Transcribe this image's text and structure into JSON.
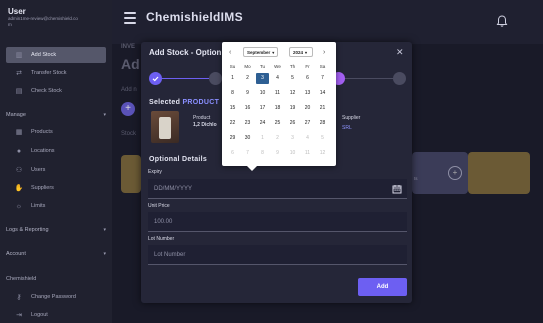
{
  "sidebar": {
    "user_name": "User",
    "user_email": "admin1me-review@chemishield.com",
    "nav_primary": [
      {
        "label": "Add Stock",
        "icon": "barcode-icon",
        "active": true
      },
      {
        "label": "Transfer Stock",
        "icon": "transfer-icon",
        "active": false
      },
      {
        "label": "Check Stock",
        "icon": "scan-icon",
        "active": false
      }
    ],
    "manage_heading": "Manage",
    "manage_items": [
      {
        "label": "Products",
        "icon": "box-icon"
      },
      {
        "label": "Locations",
        "icon": "pin-icon"
      },
      {
        "label": "Users",
        "icon": "users-icon"
      },
      {
        "label": "Suppliers",
        "icon": "hand-icon"
      },
      {
        "label": "Limits",
        "icon": "sun-icon"
      }
    ],
    "logs_heading": "Logs & Reporting",
    "account_heading": "Account",
    "account_items": [
      {
        "label": "Chemishield",
        "icon": ""
      },
      {
        "label": "Change Password",
        "icon": "key-icon"
      },
      {
        "label": "Logout",
        "icon": "logout-icon"
      }
    ]
  },
  "header": {
    "brand": "ChemishieldIMS"
  },
  "background": {
    "crumb": "INVE",
    "heading": "Ad",
    "add_text": "Add n",
    "stock_text": "Stock",
    "card_text": "ts"
  },
  "modal": {
    "title": "Add Stock - Option",
    "selected_label": "Selected",
    "selected_highlight": "PRODUCT",
    "product_label": "Product",
    "product_name": "1,2 Dichlo",
    "supplier_label": "Supplier",
    "supplier_value": "SRL",
    "optional_title": "Optional Details",
    "expiry_label": "Expiry",
    "expiry_placeholder": "DD/MM/YYYY",
    "unit_price_label": "Unit Price",
    "unit_price_value": "100.00",
    "lot_label": "Lot Number",
    "lot_placeholder": "Lot Number",
    "add_button": "Add"
  },
  "datepicker": {
    "month": "September",
    "year": "2024",
    "weekdays": [
      "Su",
      "Mo",
      "Tu",
      "We",
      "Th",
      "Fr",
      "Sa"
    ],
    "days": [
      [
        "1",
        "2",
        "3",
        "4",
        "5",
        "6",
        "7"
      ],
      [
        "8",
        "9",
        "10",
        "11",
        "12",
        "13",
        "14"
      ],
      [
        "15",
        "16",
        "17",
        "18",
        "19",
        "20",
        "21"
      ],
      [
        "22",
        "23",
        "24",
        "25",
        "26",
        "27",
        "28"
      ],
      [
        "29",
        "30",
        "1",
        "2",
        "3",
        "4",
        "5"
      ],
      [
        "6",
        "7",
        "8",
        "9",
        "10",
        "11",
        "12"
      ]
    ],
    "selected_day": "3",
    "colors": {
      "selected": "#2e5f93",
      "accent": "#6d5ff2"
    }
  }
}
